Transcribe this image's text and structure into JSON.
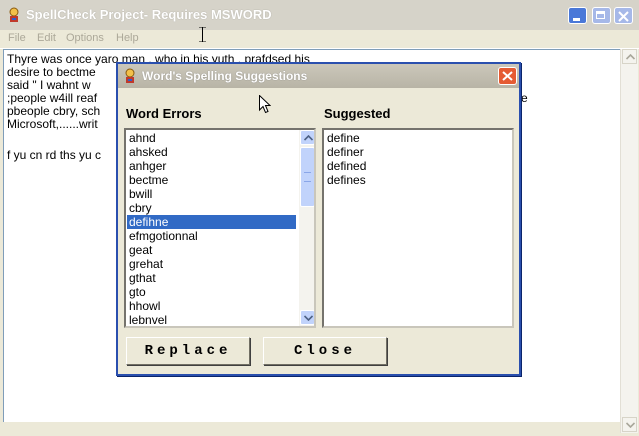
{
  "window": {
    "title": "SpellCheck Project- Requires MSWORD",
    "menu": [
      "File",
      "Edit",
      "Options",
      "Help"
    ]
  },
  "editor": {
    "lines": [
      "Thyre was once yaro man , who in his yuth , prafdsed his",
      "desire to bectme",
      "said  \" I wahnt w",
      ";people w4ill reaf",
      "pbeople cbry, sch",
      "Microsoft,......writ",
      "",
      "f yu cn rd ths yu c"
    ],
    "overflow_char": "e"
  },
  "dialog": {
    "title": "Word's Spelling Suggestions",
    "errors_header": "Word Errors",
    "suggested_header": "Suggested",
    "errors": [
      "ahnd",
      "ahsked",
      "anhger",
      "bectme",
      "bwill",
      "cbry",
      "defihne",
      "efmgotionnal",
      "geat",
      "grehat",
      "gthat",
      "gto",
      "hhowl",
      "lebnvel"
    ],
    "selected_error": "defihne",
    "suggestions": [
      "define",
      "definer",
      "defined",
      "defines"
    ],
    "replace_label": "Replace",
    "close_label": "Close"
  },
  "colors": {
    "selection": "#316ac5",
    "dialog_border": "#2a4fae",
    "close_red": "#e55b33"
  }
}
